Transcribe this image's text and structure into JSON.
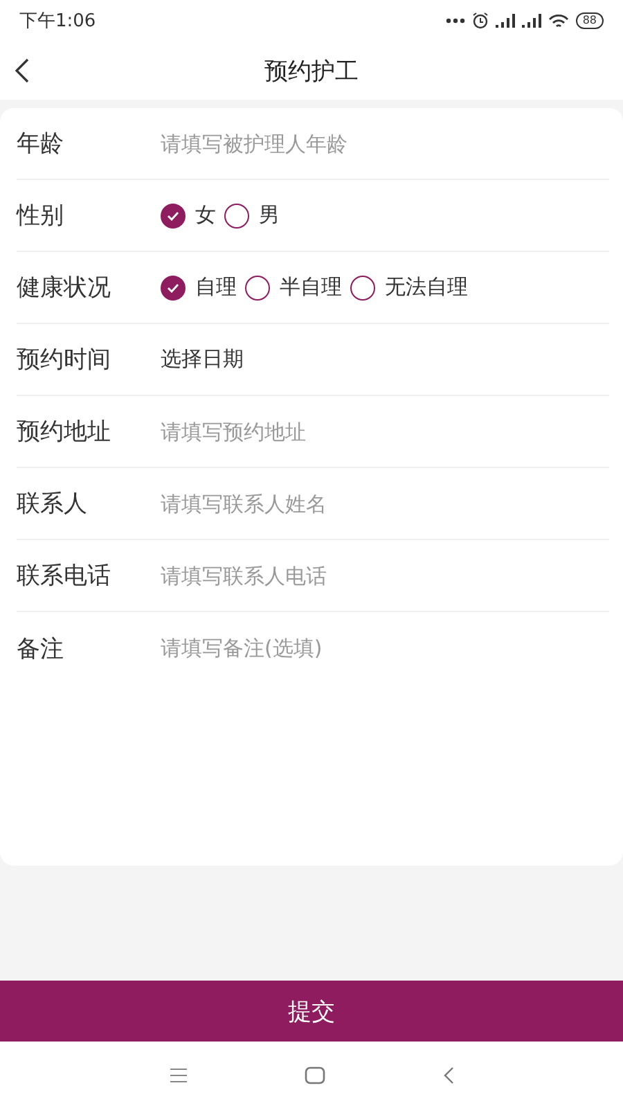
{
  "status_bar": {
    "time": "下午1:06",
    "battery": "88"
  },
  "header": {
    "title": "预约护工"
  },
  "form": {
    "rows": [
      {
        "kind": "input",
        "label": "年龄",
        "placeholder": "请填写被护理人年龄"
      },
      {
        "kind": "radio",
        "label": "性别",
        "options": [
          {
            "label": "女",
            "selected": true
          },
          {
            "label": "男",
            "selected": false
          }
        ]
      },
      {
        "kind": "radio",
        "label": "健康状况",
        "options": [
          {
            "label": "自理",
            "selected": true
          },
          {
            "label": "半自理",
            "selected": false
          },
          {
            "label": "无法自理",
            "selected": false
          }
        ]
      },
      {
        "kind": "picker",
        "label": "预约时间",
        "value": "选择日期"
      },
      {
        "kind": "input",
        "label": "预约地址",
        "placeholder": "请填写预约地址"
      },
      {
        "kind": "input",
        "label": "联系人",
        "placeholder": "请填写联系人姓名"
      },
      {
        "kind": "input",
        "label": "联系电话",
        "placeholder": "请填写联系人电话"
      },
      {
        "kind": "input",
        "label": "备注",
        "placeholder": "请填写备注(选填)"
      }
    ]
  },
  "submit_button": "提交"
}
